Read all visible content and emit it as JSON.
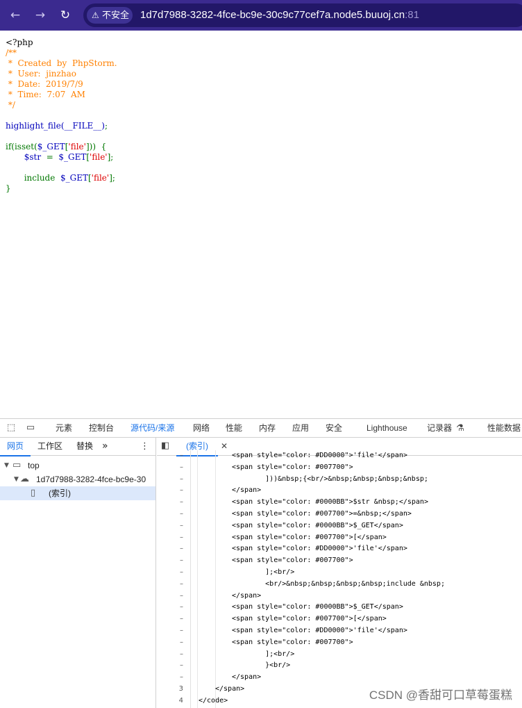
{
  "browser": {
    "security_label": "不安全",
    "url_host": "1d7d7988-3282-4fce-bc9e-30c9c77cef7a.node5.buuoj.cn",
    "url_port": ":81"
  },
  "page_code": {
    "line1": "<?php",
    "line2": "/**",
    "line3": " *  Created  by  PhpStorm.",
    "line4": " *  User:  jinzhao",
    "line5": " *  Date:  2019/7/9",
    "line6": " *  Time:  7:07  AM",
    "line7": " */",
    "line9_func": "highlight_file(__FILE__)",
    "line9_semi": ";",
    "line11_if": "if(isset(",
    "line11_get": "$_GET",
    "line11_br": "[",
    "line11_str": "'file'",
    "line11_end": "]))  {",
    "line12_var": "$str  ",
    "line12_eq": "=  ",
    "line12_get": "$_GET",
    "line12_br": "[",
    "line12_str": "'file'",
    "line12_end": "];",
    "line14_inc": "include  ",
    "line14_get": "$_GET",
    "line14_br": "[",
    "line14_str": "'file'",
    "line14_end": "];",
    "line15": "}"
  },
  "devtools": {
    "tabs": [
      "元素",
      "控制台",
      "源代码/来源",
      "网络",
      "性能",
      "内存",
      "应用",
      "安全",
      "Lighthouse",
      "记录器",
      "性能数据"
    ],
    "active_tab": "源代码/来源",
    "nav_subtabs": [
      "网页",
      "工作区",
      "替换"
    ],
    "more": "»",
    "tree": {
      "top": "top",
      "domain": "1d7d7988-3282-4fce-bc9e-30",
      "file": "(索引)"
    },
    "editor_tab": "(索引)",
    "source_lines": [
      {
        "ln": "–",
        "text": "<span style=\"color: #DD0000\">'file'</span>"
      },
      {
        "ln": "–",
        "text": "<span style=\"color: #007700\">"
      },
      {
        "ln": "–",
        "text": "    ]))&nbsp;{<br/>&nbsp;&nbsp;&nbsp;&nbsp;"
      },
      {
        "ln": "–",
        "text": "</span>"
      },
      {
        "ln": "–",
        "text": "<span style=\"color: #0000BB\">$str &nbsp;</span>"
      },
      {
        "ln": "–",
        "text": "<span style=\"color: #007700\">=&nbsp;</span>"
      },
      {
        "ln": "–",
        "text": "<span style=\"color: #0000BB\">$_GET</span>"
      },
      {
        "ln": "–",
        "text": "<span style=\"color: #007700\">[</span>"
      },
      {
        "ln": "–",
        "text": "<span style=\"color: #DD0000\">'file'</span>"
      },
      {
        "ln": "–",
        "text": "<span style=\"color: #007700\">"
      },
      {
        "ln": "–",
        "text": "    ];<br/>"
      },
      {
        "ln": "–",
        "text": "    <br/>&nbsp;&nbsp;&nbsp;&nbsp;include &nbsp;"
      },
      {
        "ln": "–",
        "text": "</span>"
      },
      {
        "ln": "–",
        "text": "<span style=\"color: #0000BB\">$_GET</span>"
      },
      {
        "ln": "–",
        "text": "<span style=\"color: #007700\">[</span>"
      },
      {
        "ln": "–",
        "text": "<span style=\"color: #DD0000\">'file'</span>"
      },
      {
        "ln": "–",
        "text": "<span style=\"color: #007700\">"
      },
      {
        "ln": "–",
        "text": "    ];<br/>"
      },
      {
        "ln": "–",
        "text": "    }<br/>"
      },
      {
        "ln": "–",
        "text": "</span>"
      },
      {
        "ln": "3",
        "text": "</span>"
      },
      {
        "ln": "4",
        "text": "</code>"
      }
    ]
  },
  "watermark": "CSDN @香甜可口草莓蛋糕",
  "colors": {
    "browser_bar": "#3b2a8f",
    "php_default": "#0000BB",
    "php_keyword": "#007700",
    "php_comment": "#FF8000",
    "php_string": "#DD0000",
    "devtools_accent": "#1a73e8"
  }
}
